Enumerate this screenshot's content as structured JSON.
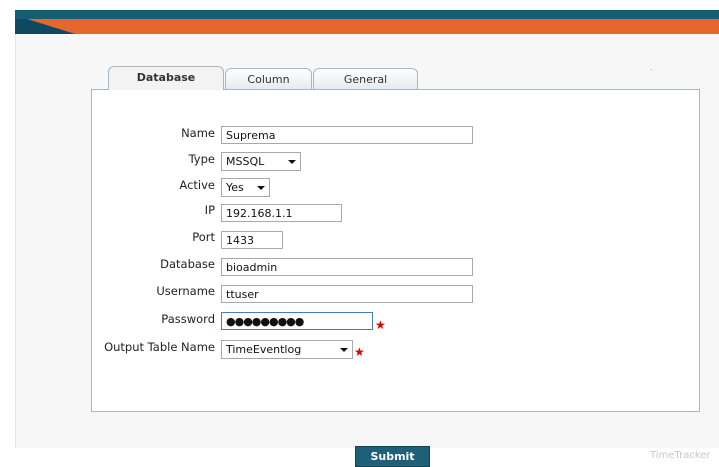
{
  "tabs": [
    {
      "label": "Database",
      "active": true
    },
    {
      "label": "Column",
      "active": false
    },
    {
      "label": "General",
      "active": false
    }
  ],
  "form": {
    "name": {
      "label": "Name",
      "value": "Suprema"
    },
    "type": {
      "label": "Type",
      "value": "MSSQL"
    },
    "active": {
      "label": "Active",
      "value": "Yes"
    },
    "ip": {
      "label": "IP",
      "value": "192.168.1.1"
    },
    "port": {
      "label": "Port",
      "value": "1433"
    },
    "database": {
      "label": "Database",
      "value": "bioadmin"
    },
    "username": {
      "label": "Username",
      "value": "ttuser"
    },
    "password": {
      "label": "Password",
      "value": "●●●●●●●●●"
    },
    "output_table": {
      "label": "Output Table Name",
      "value": "TimeEventlog"
    },
    "required_marker": "★"
  },
  "submit_label": "Submit",
  "brand": "TimeTracker",
  "colors": {
    "header_teal": "#165d74",
    "header_orange": "#e5672e",
    "button": "#1d6078",
    "required": "#e00000"
  }
}
